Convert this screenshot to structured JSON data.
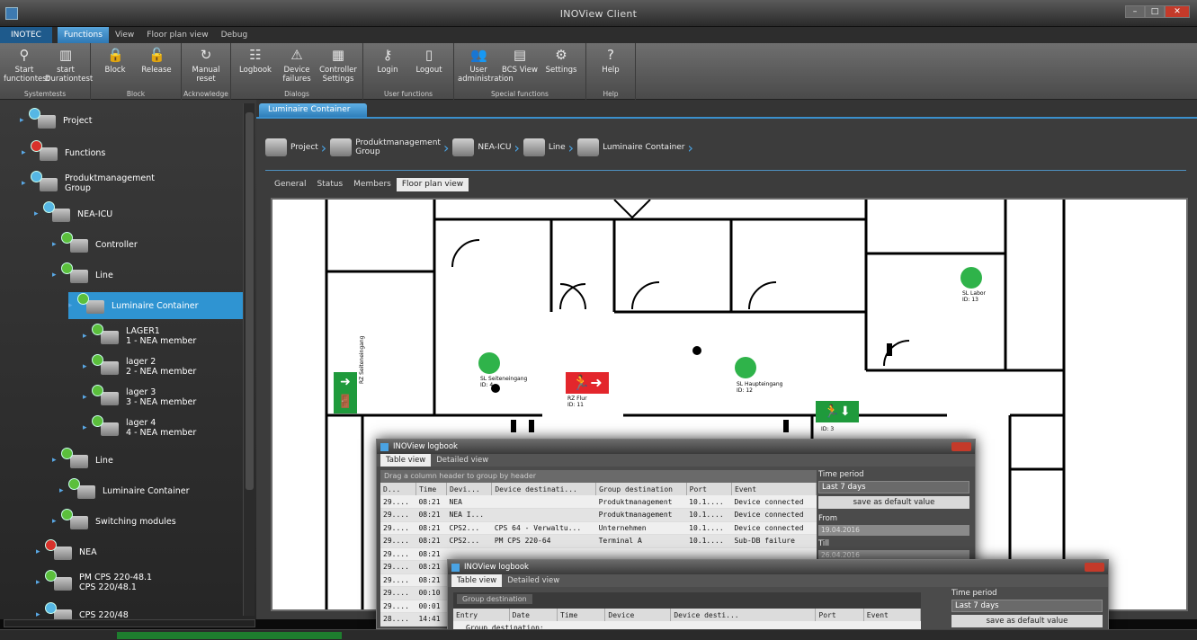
{
  "window": {
    "title": "INOView Client"
  },
  "menu": {
    "file": "INOTEC",
    "tabs": [
      "Functions",
      "View",
      "Floor plan view",
      "Debug"
    ]
  },
  "ribbon": {
    "groups": [
      {
        "label": "Systemtests",
        "buttons": [
          {
            "icon": "test-icon",
            "label": "Start functiontest"
          },
          {
            "icon": "battery-icon",
            "label": "start Durationtest"
          }
        ]
      },
      {
        "label": "Block",
        "buttons": [
          {
            "icon": "lock-icon",
            "label": "Block"
          },
          {
            "icon": "unlock-icon",
            "label": "Release"
          }
        ]
      },
      {
        "label": "Acknowledge",
        "buttons": [
          {
            "icon": "reset-icon",
            "label": "Manual reset"
          }
        ]
      },
      {
        "label": "Dialogs",
        "buttons": [
          {
            "icon": "logbook-icon",
            "label": "Logbook"
          },
          {
            "icon": "device-failures-icon",
            "label": "Device failures"
          },
          {
            "icon": "controller-icon",
            "label": "Controller Settings"
          }
        ]
      },
      {
        "label": "User functions",
        "buttons": [
          {
            "icon": "key-icon",
            "label": "Login"
          },
          {
            "icon": "door-icon",
            "label": "Logout"
          }
        ]
      },
      {
        "label": "Special functions",
        "buttons": [
          {
            "icon": "users-icon",
            "label": "User administration"
          },
          {
            "icon": "bcs-icon",
            "label": "BCS View"
          },
          {
            "icon": "settings-icon",
            "label": "Settings"
          }
        ]
      },
      {
        "label": "Help",
        "buttons": [
          {
            "icon": "help-icon",
            "label": "Help"
          }
        ]
      }
    ]
  },
  "tree": {
    "items": [
      {
        "label": "Project",
        "status": "blue"
      },
      {
        "label": "Functions",
        "status": "red"
      },
      {
        "label": "Produktmanagement\nGroup",
        "status": "blue"
      },
      {
        "label": "NEA-ICU",
        "status": "blue"
      },
      {
        "label": "Controller",
        "status": "green"
      },
      {
        "label": "Line",
        "status": "green"
      },
      {
        "label": "Luminaire Container",
        "status": "green"
      },
      {
        "label": "LAGER1\n1 - NEA member",
        "status": "green"
      },
      {
        "label": "lager 2\n2 - NEA member",
        "status": "green"
      },
      {
        "label": "lager 3\n3 - NEA member",
        "status": "green"
      },
      {
        "label": "lager 4\n4 - NEA member",
        "status": "green"
      },
      {
        "label": "Line",
        "status": "green"
      },
      {
        "label": "Luminaire Container",
        "status": "green"
      },
      {
        "label": "Switching modules",
        "status": "green"
      },
      {
        "label": "NEA",
        "status": "red"
      },
      {
        "label": "PM CPS 220-48.1\nCPS 220/48.1",
        "status": "green"
      },
      {
        "label": "CPS 220/48",
        "status": "blue"
      }
    ]
  },
  "main": {
    "doc_tab": "Luminaire Container",
    "breadcrumb": [
      "Project",
      "Produktmanagement\nGroup",
      "NEA-ICU",
      "Line",
      "Luminaire Container"
    ],
    "subtabs": [
      "General",
      "Status",
      "Members",
      "Floor plan view"
    ],
    "floorplan": {
      "labels": [
        {
          "text": "SL Seiteneingang",
          "id": "ID: 4"
        },
        {
          "text": "RZ Flur",
          "id": "ID: 11"
        },
        {
          "text": "SL Haupteingang",
          "id": "ID: 12"
        },
        {
          "text": "SL Labor",
          "id": "ID: 13"
        },
        {
          "text": "RZ Seiteneingang",
          "id": "ID: 3"
        }
      ]
    }
  },
  "logbook1": {
    "title": "INOView logbook",
    "tabs": [
      "Table view",
      "Detailed view"
    ],
    "group_hint": "Drag a column header to group by header",
    "columns": [
      "D...",
      "Time",
      "Devi...",
      "Device destinati...",
      "Group destination",
      "Port",
      "Event"
    ],
    "rows": [
      [
        "29....",
        "08:21",
        "NEA",
        "",
        "Produktmanagement",
        "10.1....",
        "Device connected"
      ],
      [
        "29....",
        "08:21",
        "NEA I...",
        "",
        "Produktmanagement",
        "10.1....",
        "Device connected"
      ],
      [
        "29....",
        "08:21",
        "CPS2...",
        "CPS 64 - Verwaltu...",
        "Unternehmen",
        "10.1....",
        "Device connected"
      ],
      [
        "29....",
        "08:21",
        "CPS2...",
        "PM CPS 220-64",
        "Terminal A",
        "10.1....",
        "Sub-DB failure"
      ],
      [
        "29....",
        "08:21",
        "",
        "",
        "",
        "",
        ""
      ],
      [
        "29....",
        "08:21",
        "",
        "",
        "",
        "",
        ""
      ],
      [
        "29....",
        "08:21",
        "",
        "",
        "",
        "",
        ""
      ],
      [
        "29....",
        "00:10",
        "",
        "",
        "",
        "",
        ""
      ],
      [
        "29....",
        "00:01",
        "",
        "",
        "",
        "",
        ""
      ],
      [
        "28....",
        "14:41",
        "",
        "",
        "",
        "",
        ""
      ]
    ],
    "panel": {
      "time_period_label": "Time period",
      "time_period": "Last 7 days",
      "default_btn": "save as default value",
      "from_label": "From",
      "from": "19.04.2016",
      "till_label": "Till",
      "till": "26.04.2016"
    }
  },
  "logbook2": {
    "title": "INOView logbook",
    "tabs": [
      "Table view",
      "Detailed view"
    ],
    "group_chip": "Group destination",
    "columns": [
      "Entry",
      "Date",
      "Time",
      "Device",
      "Device desti...",
      "Port",
      "Event"
    ],
    "sub": "Group destination:",
    "panel": {
      "time_period_label": "Time period",
      "time_period": "Last 7 days",
      "default_btn": "save as default value"
    }
  }
}
